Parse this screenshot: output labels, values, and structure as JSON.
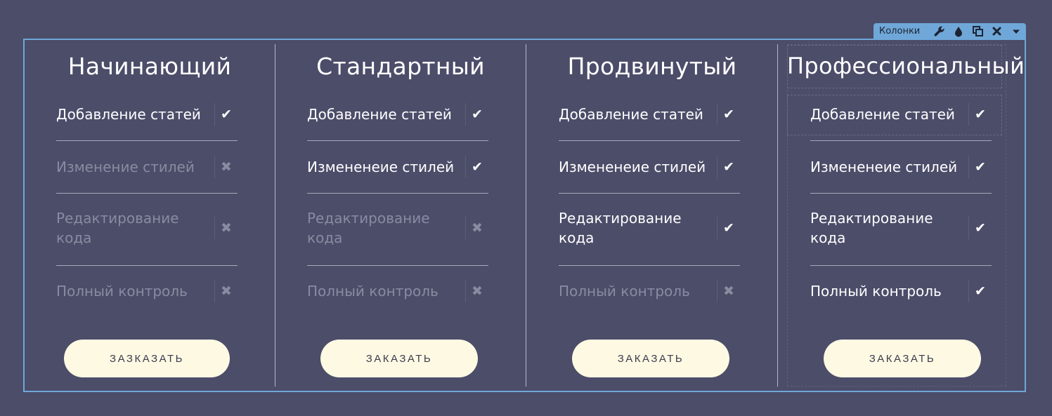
{
  "toolbar": {
    "label": "Колонки",
    "icons": [
      "wrench-icon",
      "droplet-icon",
      "duplicate-icon",
      "close-icon",
      "dropdown-arrow-icon"
    ]
  },
  "colors": {
    "background": "#4b4d69",
    "selection": "#6fa7d8",
    "button": "#fdf9e3",
    "feature_on": "#ffffff",
    "feature_off": "#8a8ba0"
  },
  "plans": [
    {
      "title": "Начинающий",
      "features": [
        {
          "name": "Добавление статей",
          "mark": "✔"
        },
        {
          "name": "Изменение стилей",
          "mark": "✖"
        },
        {
          "name": "Редактирование кода",
          "mark": "✖"
        },
        {
          "name": "Полный контроль",
          "mark": "✖"
        }
      ],
      "button": "ЗАЗКАЗАТЬ"
    },
    {
      "title": "Стандартный",
      "features": [
        {
          "name": "Добавление статей",
          "mark": "✔"
        },
        {
          "name": "Измененеие стилей",
          "mark": "✔"
        },
        {
          "name": "Редактирование кода",
          "mark": "✖"
        },
        {
          "name": "Полный контроль",
          "mark": "✖"
        }
      ],
      "button": "ЗАКАЗАТЬ"
    },
    {
      "title": "Продвинутый",
      "features": [
        {
          "name": "Добавление статей",
          "mark": "✔"
        },
        {
          "name": "Измененеие стилей",
          "mark": "✔"
        },
        {
          "name": "Редактирование кода",
          "mark": "✔"
        },
        {
          "name": "Полный контроль",
          "mark": "✖"
        }
      ],
      "button": "ЗАКАЗАТЬ"
    },
    {
      "title": "Профессиональный",
      "features": [
        {
          "name": "Добавление статей",
          "mark": "✔"
        },
        {
          "name": "Измененеие стилей",
          "mark": "✔"
        },
        {
          "name": "Редактирование кода",
          "mark": "✔"
        },
        {
          "name": "Полный контроль",
          "mark": "✔"
        }
      ],
      "button": "ЗАКАЗАТЬ"
    }
  ]
}
